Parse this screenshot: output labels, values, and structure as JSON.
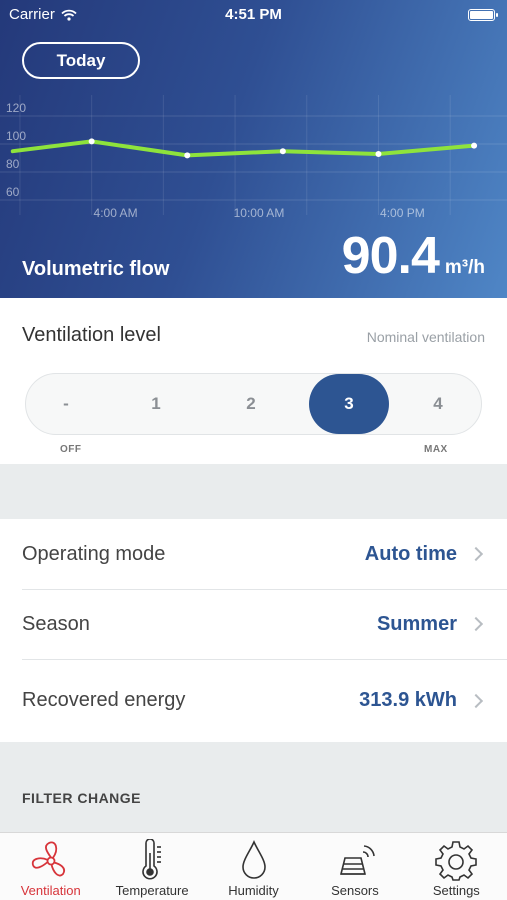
{
  "status_bar": {
    "carrier": "Carrier",
    "time": "4:51 PM"
  },
  "header": {
    "today_label": "Today",
    "flow_label": "Volumetric flow",
    "flow_value": "90.4",
    "flow_unit": "m³/h"
  },
  "chart_data": {
    "type": "line",
    "title": "",
    "xlabel": "",
    "ylabel": "",
    "x_tick_labels": [
      "4:00 AM",
      "10:00 AM",
      "4:00 PM"
    ],
    "y_tick_labels": [
      "120",
      "100",
      "80",
      "60"
    ],
    "ylim": [
      55,
      125
    ],
    "grid": true,
    "series": [
      {
        "color": "#8ee33c",
        "points": [
          {
            "x": "-0.3h",
            "y": 92
          },
          {
            "x": "3:00 AM",
            "y": 99
          },
          {
            "x": "7:00 AM",
            "y": 89
          },
          {
            "x": "11:00 AM",
            "y": 92
          },
          {
            "x": "3:00 PM",
            "y": 90
          },
          {
            "x": "7:00 PM",
            "y": 96
          }
        ],
        "x_hours": [
          -0.3,
          3,
          7,
          11,
          15,
          19
        ],
        "values": [
          92,
          99,
          89,
          92,
          90,
          96
        ]
      }
    ]
  },
  "ventilation": {
    "title": "Ventilation level",
    "subtitle": "Nominal ventilation",
    "levels": [
      "-",
      "1",
      "2",
      "3",
      "4"
    ],
    "selected_level": "3",
    "min_caption": "OFF",
    "max_caption": "MAX"
  },
  "rows": [
    {
      "label": "Operating mode",
      "value": "Auto time"
    },
    {
      "label": "Season",
      "value": "Summer"
    },
    {
      "label": "Recovered energy",
      "value": "313.9 kWh"
    }
  ],
  "filter": {
    "title": "FILTER CHANGE"
  },
  "tabs": [
    {
      "label": "Ventilation",
      "icon": "fan-icon",
      "active": true
    },
    {
      "label": "Temperature",
      "icon": "thermometer-icon",
      "active": false
    },
    {
      "label": "Humidity",
      "icon": "droplet-icon",
      "active": false
    },
    {
      "label": "Sensors",
      "icon": "sensor-icon",
      "active": false
    },
    {
      "label": "Settings",
      "icon": "gear-icon",
      "active": false
    }
  ],
  "colors": {
    "accent": "#2d5592",
    "active_tab": "#d7343a",
    "chart_line": "#8ee33c"
  }
}
